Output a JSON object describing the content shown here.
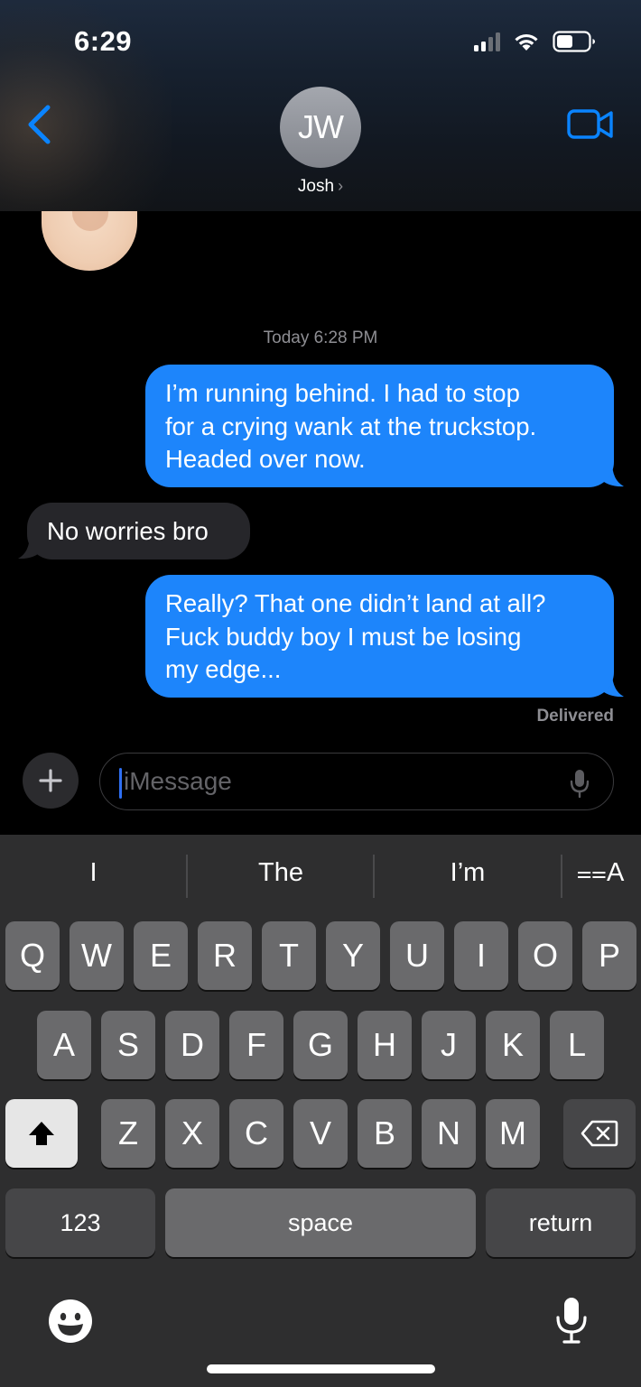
{
  "status_bar": {
    "time": "6:29"
  },
  "header": {
    "avatar_initials": "JW",
    "contact_name": "Josh",
    "name_chevron": "›"
  },
  "conversation": {
    "timestamp": "Today 6:28 PM",
    "messages": [
      {
        "direction": "sent",
        "text": "I’m running behind. I had to stop\nfor a crying wank at the truckstop.\nHeaded over now."
      },
      {
        "direction": "received",
        "text": "No worries bro"
      },
      {
        "direction": "sent",
        "text": "Really? That one didn’t land at all?\nFuck buddy boy I must be losing\nmy edge..."
      }
    ],
    "delivery_status": "Delivered"
  },
  "compose": {
    "placeholder": "iMessage",
    "plus_label": "+"
  },
  "keyboard": {
    "suggestions": [
      "I",
      "The",
      "I’m"
    ],
    "format_label": "⩵A",
    "row1": [
      "Q",
      "W",
      "E",
      "R",
      "T",
      "Y",
      "U",
      "I",
      "O",
      "P"
    ],
    "row2": [
      "A",
      "S",
      "D",
      "F",
      "G",
      "H",
      "J",
      "K",
      "L"
    ],
    "row3": [
      "Z",
      "X",
      "C",
      "V",
      "B",
      "N",
      "M"
    ],
    "numbers_key": "123",
    "space_key": "space",
    "return_key": "return"
  },
  "colors": {
    "sent_bubble": "#1d85fb",
    "received_bubble": "#26262a",
    "accent": "#0a84ff",
    "keyboard_bg": "#2e2e2f",
    "key_bg": "#6a6a6c"
  },
  "icons": [
    "back-chevron-icon",
    "video-camera-icon",
    "signal-icon",
    "wifi-icon",
    "battery-icon",
    "plus-icon",
    "microphone-icon",
    "delete-icon",
    "shift-icon",
    "emoji-icon",
    "dictation-icon"
  ]
}
